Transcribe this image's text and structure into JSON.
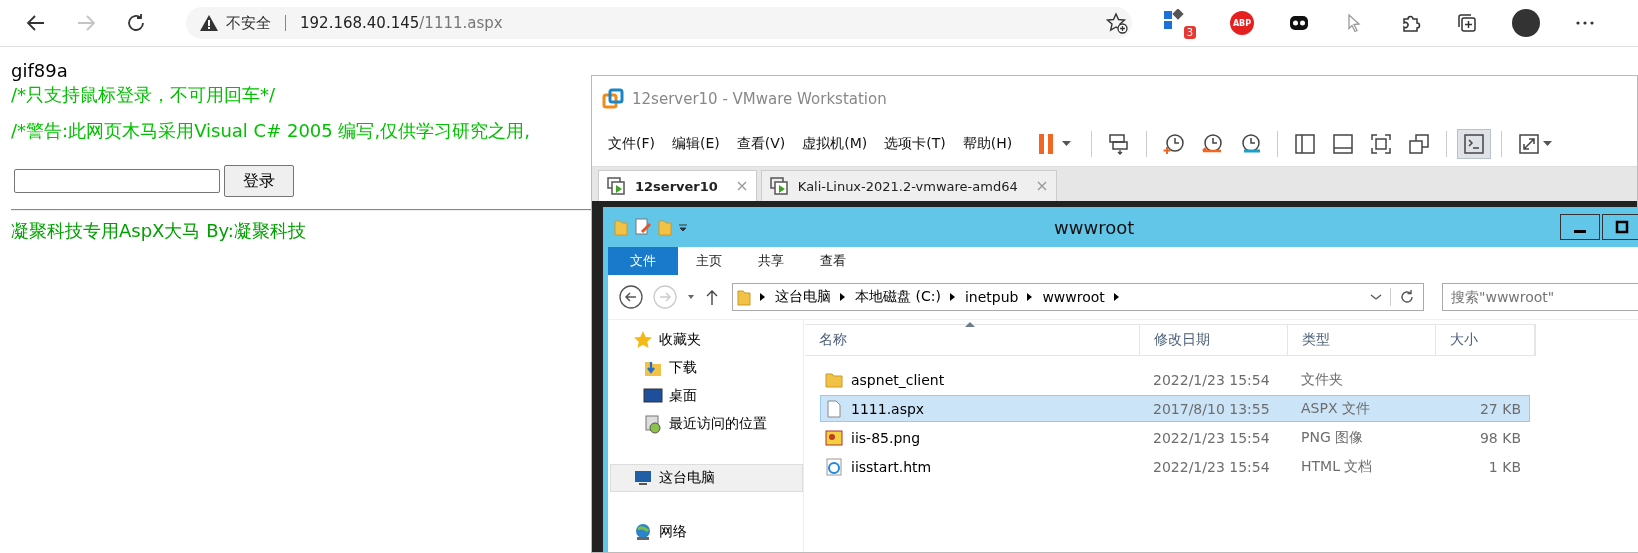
{
  "browser": {
    "nav": [
      {
        "kind": "back",
        "disabled": false
      },
      {
        "kind": "forward",
        "disabled": true
      },
      {
        "kind": "refresh",
        "disabled": false
      }
    ],
    "security_label": "不安全",
    "url_host": "192.168.40.145",
    "url_path": "/1111.aspx",
    "extensions": [
      {
        "kind": "favorite-add"
      },
      {
        "kind": "apps",
        "badge": "3"
      },
      {
        "kind": "abp",
        "label": "ABP"
      },
      {
        "kind": "mask"
      },
      {
        "kind": "cursor"
      },
      {
        "kind": "puzzle"
      },
      {
        "kind": "collections"
      },
      {
        "kind": "avatar"
      },
      {
        "kind": "more"
      }
    ]
  },
  "page": {
    "header": "gif89a",
    "notice": "/*只支持鼠标登录，不可用回车*/",
    "warning": "/*警告:此网页木马采用Visual C# 2005 编写,仅供学习研究之用,",
    "login_button": "登录",
    "footer": "凝聚科技专用AspX大马 By:凝聚科技"
  },
  "vmware": {
    "title": "12server10 - VMware Workstation",
    "menu": [
      "文件(F)",
      "编辑(E)",
      "查看(V)",
      "虚拟机(M)",
      "选项卡(T)",
      "帮助(H)"
    ],
    "toolbar": [
      {
        "kind": "pause",
        "pressed": false
      },
      {
        "kind": "sep"
      },
      {
        "kind": "send-keys",
        "pressed": false
      },
      {
        "kind": "sep"
      },
      {
        "kind": "snapshot",
        "pressed": false
      },
      {
        "kind": "revert",
        "pressed": false
      },
      {
        "kind": "manage",
        "pressed": false
      },
      {
        "kind": "sep"
      },
      {
        "kind": "sidebar",
        "pressed": false
      },
      {
        "kind": "thumbs",
        "pressed": false
      },
      {
        "kind": "fullscreen",
        "pressed": false
      },
      {
        "kind": "unity",
        "pressed": false
      },
      {
        "kind": "sep"
      },
      {
        "kind": "console",
        "pressed": true
      },
      {
        "kind": "sep"
      },
      {
        "kind": "stretch",
        "pressed": false
      }
    ],
    "tabs": [
      {
        "label": "12server10",
        "selected": true
      },
      {
        "label": "Kali-Linux-2021.2-vmware-amd64",
        "selected": false
      }
    ],
    "explorer": {
      "title": "wwwroot",
      "ribbon_tabs": [
        {
          "label": "文件",
          "selected": true
        },
        {
          "label": "主页",
          "selected": false
        },
        {
          "label": "共享",
          "selected": false
        },
        {
          "label": "查看",
          "selected": false
        }
      ],
      "breadcrumbs": [
        "这台电脑",
        "本地磁盘 (C:)",
        "inetpub",
        "wwwroot"
      ],
      "search": {
        "placeholder": "搜索\"wwwroot\""
      },
      "nav": [
        {
          "kind": "favorites",
          "label": "收藏夹",
          "selected": false,
          "children": [
            {
              "kind": "download",
              "label": "下载",
              "selected": false
            },
            {
              "kind": "desktop",
              "label": "桌面",
              "selected": false
            },
            {
              "kind": "recent",
              "label": "最近访问的位置",
              "selected": false
            }
          ]
        },
        {
          "kind": "computer",
          "label": "这台电脑",
          "selected": true
        },
        {
          "kind": "network",
          "label": "网络",
          "selected": false
        }
      ],
      "columns": [
        "名称",
        "修改日期",
        "类型",
        "大小"
      ],
      "rows": [
        {
          "kind": "folder",
          "name": "aspnet_client",
          "date": "2022/1/23 15:54",
          "type": "文件夹",
          "size": "",
          "selected": false
        },
        {
          "kind": "file",
          "name": "1111.aspx",
          "date": "2017/8/10 13:55",
          "type": "ASPX 文件",
          "size": "27 KB",
          "selected": true
        },
        {
          "kind": "image",
          "name": "iis-85.png",
          "date": "2022/1/23 15:54",
          "type": "PNG 图像",
          "size": "98 KB",
          "selected": false
        },
        {
          "kind": "web",
          "name": "iisstart.htm",
          "date": "2022/1/23 15:54",
          "type": "HTML 文档",
          "size": "1 KB",
          "selected": false
        }
      ]
    }
  }
}
